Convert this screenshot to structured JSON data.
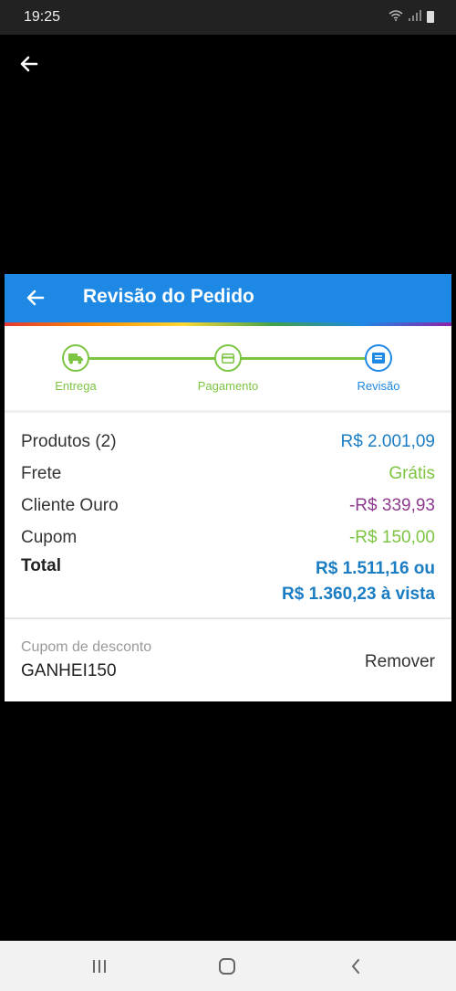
{
  "status_bar": {
    "time": "19:25"
  },
  "header": {
    "title": "Revisão do Pedido"
  },
  "steps": [
    {
      "label": "Entrega",
      "icon": "truck-icon",
      "color": "#7dc443"
    },
    {
      "label": "Pagamento",
      "icon": "credit-card-icon",
      "color": "#7dc443"
    },
    {
      "label": "Revisão",
      "icon": "list-icon",
      "color": "#1e88e5"
    }
  ],
  "summary": {
    "products_label": "Produtos (2)",
    "products_value": "R$ 2.001,09",
    "shipping_label": "Frete",
    "shipping_value": "Grátis",
    "gold_label": "Cliente Ouro",
    "gold_value": "-R$ 339,93",
    "coupon_label": "Cupom",
    "coupon_value": "-R$ 150,00",
    "total_label": "Total",
    "total_installment": "R$ 1.511,16 ou",
    "total_cash": "R$ 1.360,23 à vista"
  },
  "coupon": {
    "caption": "Cupom de desconto",
    "code": "GANHEI150",
    "remove_label": "Remover"
  },
  "colors": {
    "primary": "#1e88e5",
    "green": "#7dc443",
    "purple": "#8e3a8e",
    "blue_value": "#1a7dc4"
  }
}
